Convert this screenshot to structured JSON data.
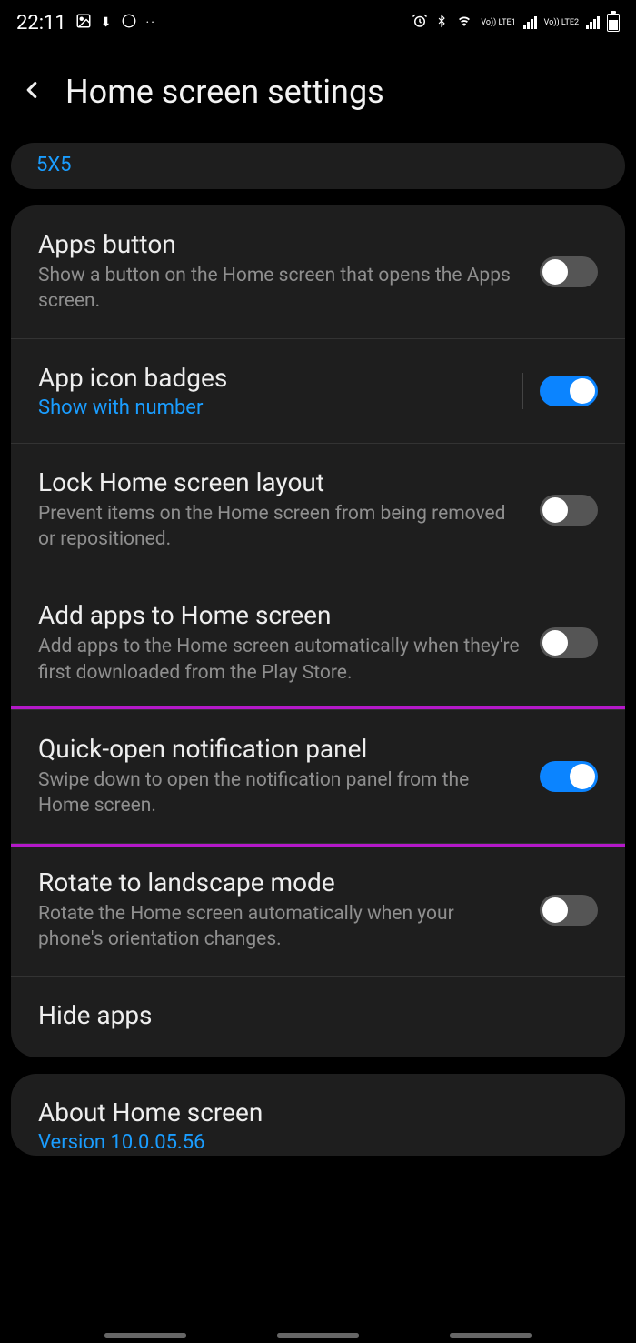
{
  "status_bar": {
    "time": "22:11",
    "net1": "Vo)) LTE1",
    "net2": "Vo)) LTE2"
  },
  "header": {
    "title": "Home screen settings"
  },
  "grid": {
    "value": "5X5"
  },
  "settings": {
    "apps_button": {
      "title": "Apps button",
      "desc": "Show a button on the Home screen that opens the Apps screen."
    },
    "app_icon_badges": {
      "title": "App icon badges",
      "sublink": "Show with number"
    },
    "lock_layout": {
      "title": "Lock Home screen layout",
      "desc": "Prevent items on the Home screen from being removed or repositioned."
    },
    "add_apps": {
      "title": "Add apps to Home screen",
      "desc": "Add apps to the Home screen automatically when they're first downloaded from the Play Store."
    },
    "quick_open": {
      "title": "Quick-open notification panel",
      "desc": "Swipe down to open the notification panel from the Home screen."
    },
    "rotate": {
      "title": "Rotate to landscape mode",
      "desc": "Rotate the Home screen automatically when your phone's orientation changes."
    },
    "hide_apps": {
      "title": "Hide apps"
    }
  },
  "about": {
    "title": "About Home screen",
    "version": "Version 10.0.05.56"
  }
}
